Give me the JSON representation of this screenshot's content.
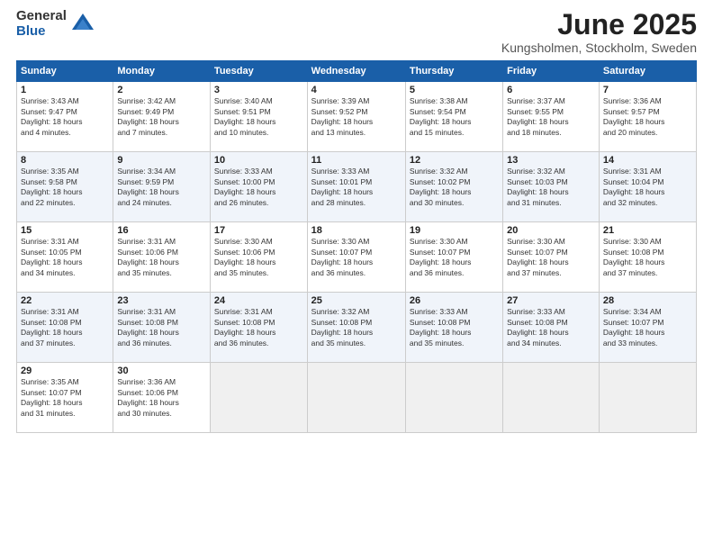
{
  "header": {
    "logo_general": "General",
    "logo_blue": "Blue",
    "month_title": "June 2025",
    "subtitle": "Kungsholmen, Stockholm, Sweden"
  },
  "days_of_week": [
    "Sunday",
    "Monday",
    "Tuesday",
    "Wednesday",
    "Thursday",
    "Friday",
    "Saturday"
  ],
  "weeks": [
    [
      {
        "day": "1",
        "sunrise": "3:43 AM",
        "sunset": "9:47 PM",
        "daylight": "18 hours and 4 minutes."
      },
      {
        "day": "2",
        "sunrise": "3:42 AM",
        "sunset": "9:49 PM",
        "daylight": "18 hours and 7 minutes."
      },
      {
        "day": "3",
        "sunrise": "3:40 AM",
        "sunset": "9:51 PM",
        "daylight": "18 hours and 10 minutes."
      },
      {
        "day": "4",
        "sunrise": "3:39 AM",
        "sunset": "9:52 PM",
        "daylight": "18 hours and 13 minutes."
      },
      {
        "day": "5",
        "sunrise": "3:38 AM",
        "sunset": "9:54 PM",
        "daylight": "18 hours and 15 minutes."
      },
      {
        "day": "6",
        "sunrise": "3:37 AM",
        "sunset": "9:55 PM",
        "daylight": "18 hours and 18 minutes."
      },
      {
        "day": "7",
        "sunrise": "3:36 AM",
        "sunset": "9:57 PM",
        "daylight": "18 hours and 20 minutes."
      }
    ],
    [
      {
        "day": "8",
        "sunrise": "3:35 AM",
        "sunset": "9:58 PM",
        "daylight": "18 hours and 22 minutes."
      },
      {
        "day": "9",
        "sunrise": "3:34 AM",
        "sunset": "9:59 PM",
        "daylight": "18 hours and 24 minutes."
      },
      {
        "day": "10",
        "sunrise": "3:33 AM",
        "sunset": "10:00 PM",
        "daylight": "18 hours and 26 minutes."
      },
      {
        "day": "11",
        "sunrise": "3:33 AM",
        "sunset": "10:01 PM",
        "daylight": "18 hours and 28 minutes."
      },
      {
        "day": "12",
        "sunrise": "3:32 AM",
        "sunset": "10:02 PM",
        "daylight": "18 hours and 30 minutes."
      },
      {
        "day": "13",
        "sunrise": "3:32 AM",
        "sunset": "10:03 PM",
        "daylight": "18 hours and 31 minutes."
      },
      {
        "day": "14",
        "sunrise": "3:31 AM",
        "sunset": "10:04 PM",
        "daylight": "18 hours and 32 minutes."
      }
    ],
    [
      {
        "day": "15",
        "sunrise": "3:31 AM",
        "sunset": "10:05 PM",
        "daylight": "18 hours and 34 minutes."
      },
      {
        "day": "16",
        "sunrise": "3:31 AM",
        "sunset": "10:06 PM",
        "daylight": "18 hours and 35 minutes."
      },
      {
        "day": "17",
        "sunrise": "3:30 AM",
        "sunset": "10:06 PM",
        "daylight": "18 hours and 35 minutes."
      },
      {
        "day": "18",
        "sunrise": "3:30 AM",
        "sunset": "10:07 PM",
        "daylight": "18 hours and 36 minutes."
      },
      {
        "day": "19",
        "sunrise": "3:30 AM",
        "sunset": "10:07 PM",
        "daylight": "18 hours and 36 minutes."
      },
      {
        "day": "20",
        "sunrise": "3:30 AM",
        "sunset": "10:07 PM",
        "daylight": "18 hours and 37 minutes."
      },
      {
        "day": "21",
        "sunrise": "3:30 AM",
        "sunset": "10:08 PM",
        "daylight": "18 hours and 37 minutes."
      }
    ],
    [
      {
        "day": "22",
        "sunrise": "3:31 AM",
        "sunset": "10:08 PM",
        "daylight": "18 hours and 37 minutes."
      },
      {
        "day": "23",
        "sunrise": "3:31 AM",
        "sunset": "10:08 PM",
        "daylight": "18 hours and 36 minutes."
      },
      {
        "day": "24",
        "sunrise": "3:31 AM",
        "sunset": "10:08 PM",
        "daylight": "18 hours and 36 minutes."
      },
      {
        "day": "25",
        "sunrise": "3:32 AM",
        "sunset": "10:08 PM",
        "daylight": "18 hours and 35 minutes."
      },
      {
        "day": "26",
        "sunrise": "3:33 AM",
        "sunset": "10:08 PM",
        "daylight": "18 hours and 35 minutes."
      },
      {
        "day": "27",
        "sunrise": "3:33 AM",
        "sunset": "10:08 PM",
        "daylight": "18 hours and 34 minutes."
      },
      {
        "day": "28",
        "sunrise": "3:34 AM",
        "sunset": "10:07 PM",
        "daylight": "18 hours and 33 minutes."
      }
    ],
    [
      {
        "day": "29",
        "sunrise": "3:35 AM",
        "sunset": "10:07 PM",
        "daylight": "18 hours and 31 minutes."
      },
      {
        "day": "30",
        "sunrise": "3:36 AM",
        "sunset": "10:06 PM",
        "daylight": "18 hours and 30 minutes."
      },
      null,
      null,
      null,
      null,
      null
    ]
  ],
  "labels": {
    "sunrise": "Sunrise:",
    "sunset": "Sunset:",
    "daylight": "Daylight:"
  }
}
